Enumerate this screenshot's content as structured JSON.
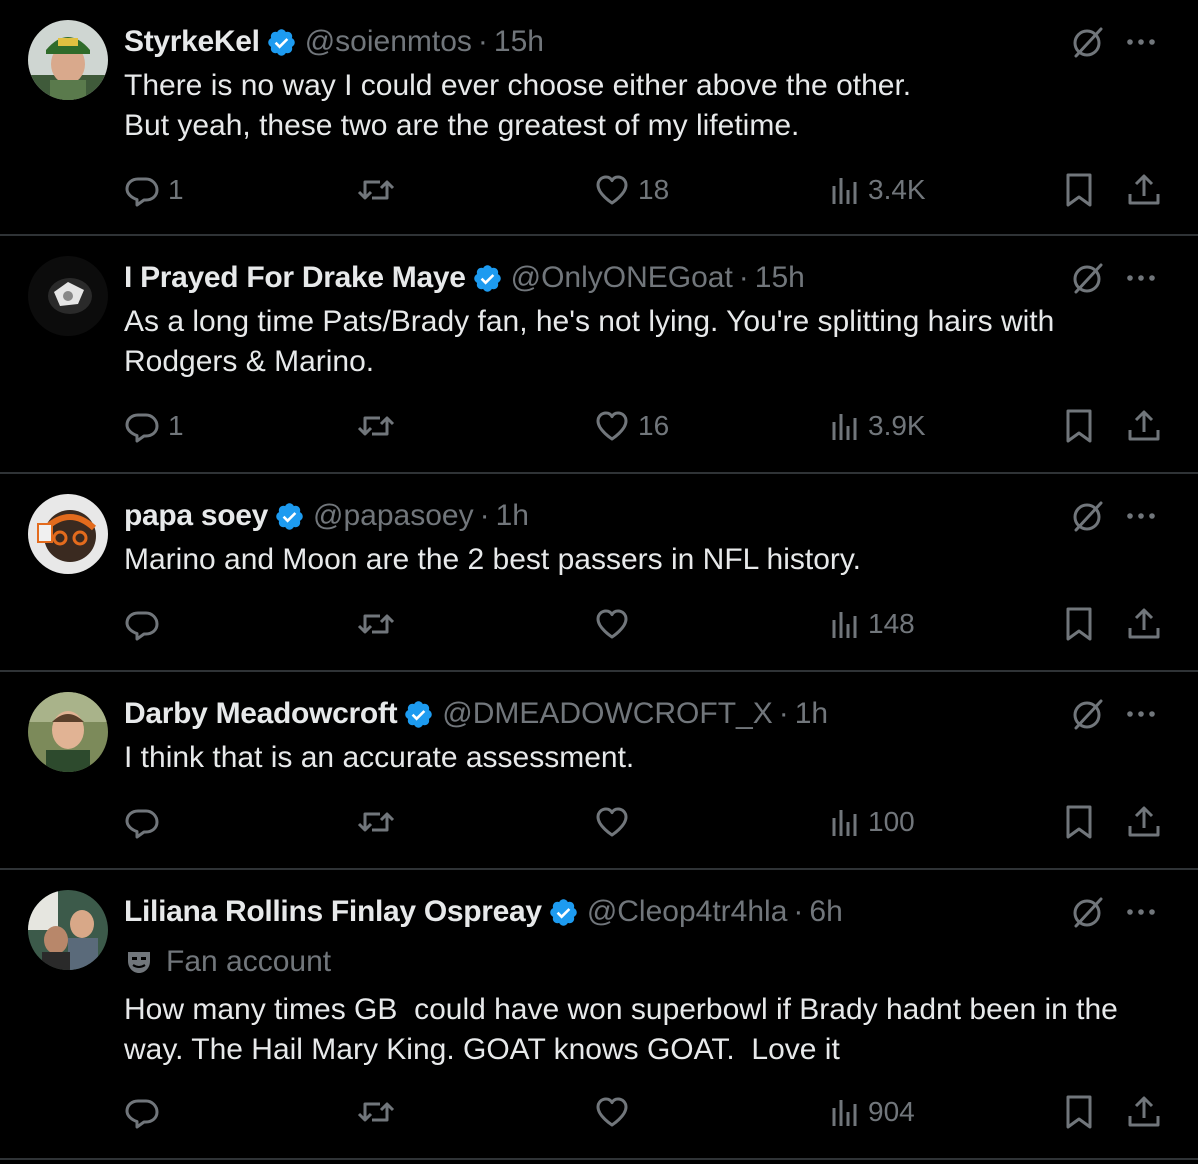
{
  "colors": {
    "background": "#000000",
    "text": "#e7e9ea",
    "muted": "#71767b",
    "verified_blue": "#1d9bf0",
    "divider": "#2f3336"
  },
  "posts": [
    {
      "name": "StyrkeKel",
      "handle": "@soienmtos",
      "dot": "·",
      "time": "15h",
      "text": "There is no way I could ever choose either above the other.\nBut yeah, these two are the greatest of my lifetime.",
      "replies": "1",
      "reposts": "",
      "likes": "18",
      "views": "3.4K"
    },
    {
      "name": "I Prayed For Drake Maye",
      "handle": "@OnlyONEGoat",
      "dot": "·",
      "time": "15h",
      "text": "As a long time Pats/Brady fan, he's not lying. You're splitting hairs with Rodgers & Marino.",
      "replies": "1",
      "reposts": "",
      "likes": "16",
      "views": "3.9K"
    },
    {
      "name": "papa soey",
      "handle": "@papasoey",
      "dot": "·",
      "time": "1h",
      "text": "Marino and Moon are the 2 best passers in NFL history.",
      "replies": "",
      "reposts": "",
      "likes": "",
      "views": "148"
    },
    {
      "name": "Darby Meadowcroft",
      "handle": "@DMEADOWCROFT_X",
      "dot": "·",
      "time": "1h",
      "text": "I think that is an accurate assessment.",
      "replies": "",
      "reposts": "",
      "likes": "",
      "views": "100"
    },
    {
      "name": "Liliana Rollins Finlay Ospreay",
      "handle": "@Cleop4tr4hla",
      "dot": "·",
      "time": "6h",
      "label": "Fan account",
      "text": "How many times GB  could have won superbowl if Brady hadnt been in the way. The Hail Mary King. GOAT knows GOAT.  Love it",
      "replies": "",
      "reposts": "",
      "likes": "",
      "views": "904"
    }
  ]
}
